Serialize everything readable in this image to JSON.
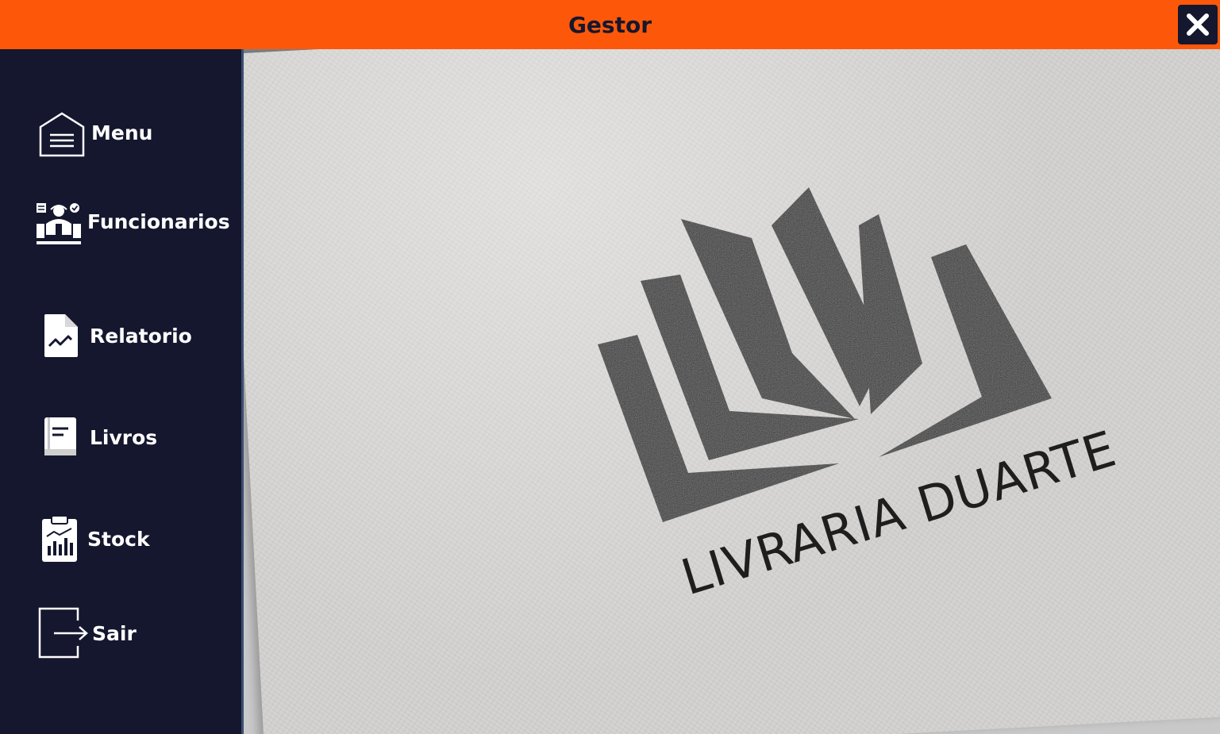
{
  "window": {
    "title": "Gestor",
    "close_icon": "close-icon",
    "accent_color": "#fd5809",
    "sidebar_color": "#15172f"
  },
  "sidebar": {
    "items": [
      {
        "label": "Menu",
        "icon": "menu-icon"
      },
      {
        "label": "Funcionarios",
        "icon": "employees-icon"
      },
      {
        "label": "Relatorio",
        "icon": "report-icon"
      },
      {
        "label": "Livros",
        "icon": "book-icon"
      },
      {
        "label": "Stock",
        "icon": "clipboard-chart-icon"
      },
      {
        "label": "Sair",
        "icon": "logout-icon"
      }
    ]
  },
  "main": {
    "logo_text": "LIVRARIA DUARTE",
    "logo_icon": "open-book-logo-icon"
  }
}
